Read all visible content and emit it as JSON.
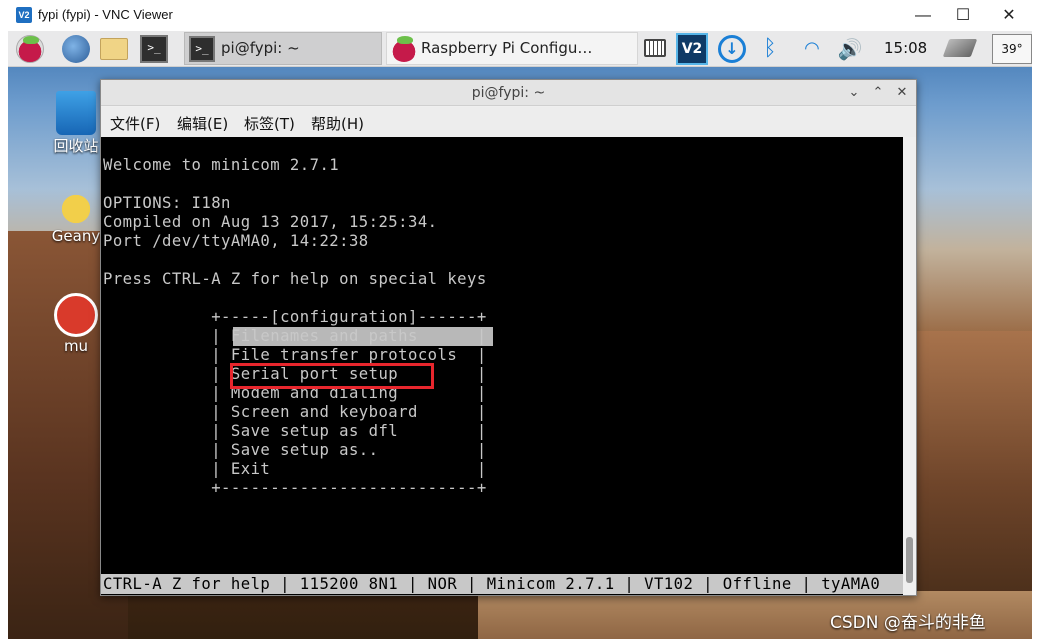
{
  "vnc": {
    "logo": "V2",
    "title": "fypi (fypi) - VNC Viewer",
    "minimize": "—",
    "maximize": "☐",
    "close": "✕"
  },
  "taskbar": {
    "terminal_button_label": "pi@fypi: ~",
    "rpi_config_label": "Raspberry Pi Configu…",
    "clock": "15:08",
    "temperature": "39°"
  },
  "desktop": {
    "icons": [
      {
        "label": "回收站"
      },
      {
        "label": "Geany"
      },
      {
        "label": "mu"
      }
    ]
  },
  "terminal": {
    "title": "pi@fypi: ~",
    "controls": [
      "⌄",
      "⌃",
      "✕"
    ],
    "menu": [
      "文件(F)",
      "编辑(E)",
      "标签(T)",
      "帮助(H)"
    ],
    "lines": [
      "Welcome to minicom 2.7.1",
      "",
      "OPTIONS: I18n",
      "Compiled on Aug 13 2017, 15:25:34.",
      "Port /dev/ttyAMA0, 14:22:38",
      "",
      "Press CTRL-A Z for help on special keys",
      "",
      "           +-----[configuration]------+",
      "           | Filenames and paths      |",
      "           | File transfer protocols  |",
      "           | Serial port setup        |",
      "           | Modem and dialing        |",
      "           | Screen and keyboard      |",
      "           | Save setup as dfl        |",
      "           | Save setup as..          |",
      "           | Exit                     |",
      "           +--------------------------+"
    ],
    "status": "CTRL-A Z for help | 115200 8N1 | NOR | Minicom 2.7.1 | VT102 | Offline | tyAMA0"
  },
  "watermark": "CSDN @奋斗的非鱼",
  "colors": {
    "highlight_box": "#e8262d",
    "terminal_bg": "#000000",
    "terminal_fg": "#c8c8c8",
    "selection": "#b8b8b8"
  }
}
